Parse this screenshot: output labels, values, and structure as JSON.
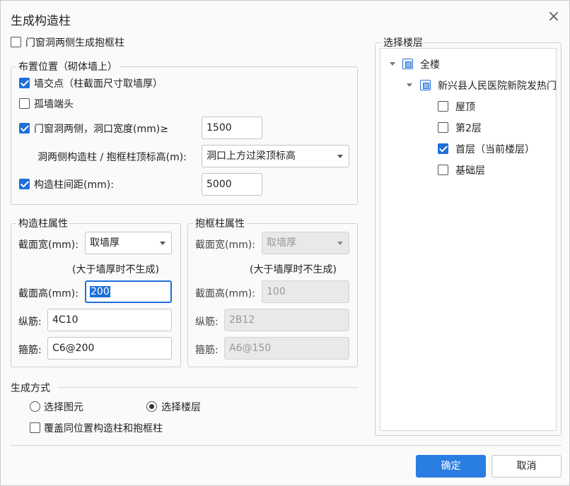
{
  "dialog": {
    "title": "生成构造柱"
  },
  "top_option": {
    "label": "门窗洞两侧生成抱框柱",
    "checked": false
  },
  "placement": {
    "legend": "布置位置（砌体墙上）",
    "wall_intersection": {
      "label": "墙交点（柱截面尺寸取墙厚）",
      "checked": true
    },
    "isolated_wall_end": {
      "label": "孤墙端头",
      "checked": false
    },
    "opening_sides": {
      "label": "门窗洞两侧，洞口宽度(mm)≥",
      "checked": true,
      "value": "1500"
    },
    "top_elevation": {
      "label": "洞两侧构造柱 / 抱框柱顶标高(m):",
      "value": "洞口上方过梁顶标高"
    },
    "spacing": {
      "label": "构造柱间距(mm):",
      "checked": true,
      "value": "5000"
    }
  },
  "column_props": {
    "legend": "构造柱属性",
    "section_width_label": "截面宽(mm):",
    "section_width_value": "取墙厚",
    "note": "(大于墙厚时不生成)",
    "section_height_label": "截面高(mm):",
    "section_height_value": "200",
    "long_bar_label": "纵筋:",
    "long_bar_value": "4C10",
    "stirrup_label": "箍筋:",
    "stirrup_value": "C6@200"
  },
  "frame_props": {
    "legend": "抱框柱属性",
    "section_width_label": "截面宽(mm):",
    "section_width_value": "取墙厚",
    "note": "(大于墙厚时不生成)",
    "section_height_label": "截面高(mm):",
    "section_height_value": "100",
    "long_bar_label": "纵筋:",
    "long_bar_value": "2B12",
    "stirrup_label": "箍筋:",
    "stirrup_value": "A6@150"
  },
  "generate_mode": {
    "legend": "生成方式",
    "option_elements": "选择图元",
    "option_floors": "选择楼层",
    "selected": "选择楼层",
    "overwrite": {
      "label": "覆盖同位置构造柱和抱框柱",
      "checked": false
    }
  },
  "floor_select": {
    "legend": "选择楼层",
    "tree": {
      "root": {
        "label": "全楼",
        "state": "partial"
      },
      "project": {
        "label": "新兴县人民医院新院发热门",
        "state": "partial"
      },
      "floors": [
        {
          "label": "屋顶",
          "checked": false
        },
        {
          "label": "第2层",
          "checked": false
        },
        {
          "label": "首层（当前楼层）",
          "checked": true
        },
        {
          "label": "基础层",
          "checked": false
        }
      ]
    }
  },
  "buttons": {
    "ok": "确定",
    "cancel": "取消"
  },
  "colors": {
    "accent": "#1e6fd9",
    "primary_button": "#2a7de1"
  }
}
